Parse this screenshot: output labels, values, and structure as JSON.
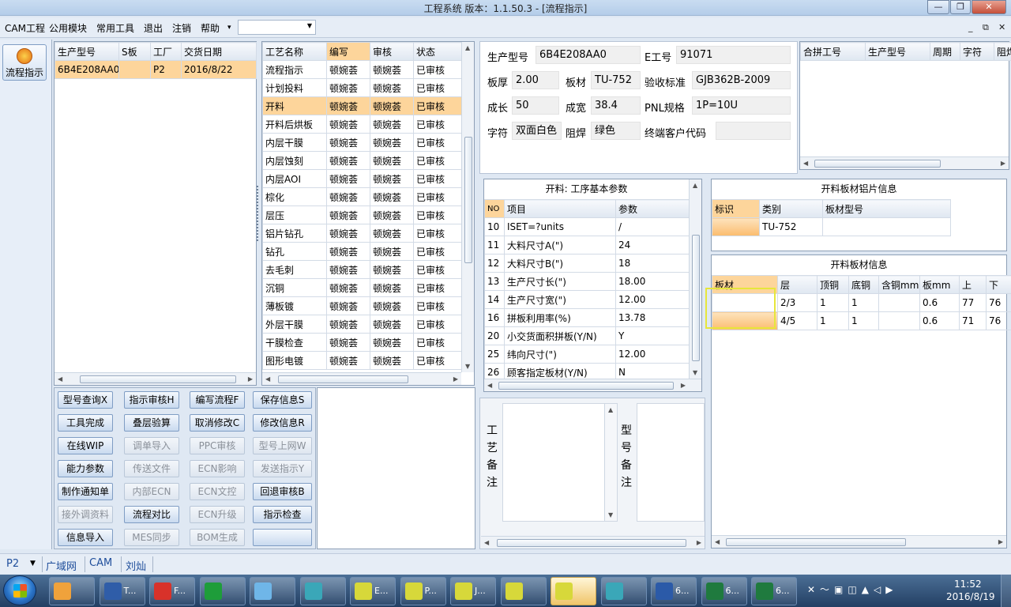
{
  "window": {
    "title": "工程系统   版本：1.1.50.3 - [流程指示]"
  },
  "menu": {
    "items": [
      "CAM工程",
      "公用模块",
      "常用工具",
      "退出",
      "注销",
      "帮助"
    ],
    "help_arrow": "▾",
    "mdi_controls": [
      "_",
      "⧉",
      "✕"
    ]
  },
  "sidebar": {
    "button_label": "流程指示"
  },
  "model_grid": {
    "columns": [
      "生产型号",
      "S板",
      "工厂",
      "交货日期"
    ],
    "rows": [
      [
        "6B4E208AA0",
        "",
        "P2",
        "2016/8/22"
      ]
    ]
  },
  "process_grid": {
    "columns": [
      "工艺名称",
      "编写",
      "审核",
      "状态"
    ],
    "selected_index": 2,
    "rows": [
      [
        "流程指示",
        "顿婉荟",
        "顿婉荟",
        "已审核"
      ],
      [
        "计划投料",
        "顿婉荟",
        "顿婉荟",
        "已审核"
      ],
      [
        "开料",
        "顿婉荟",
        "顿婉荟",
        "已审核"
      ],
      [
        "开料后烘板",
        "顿婉荟",
        "顿婉荟",
        "已审核"
      ],
      [
        "内层干膜",
        "顿婉荟",
        "顿婉荟",
        "已审核"
      ],
      [
        "内层蚀刻",
        "顿婉荟",
        "顿婉荟",
        "已审核"
      ],
      [
        "内层AOI",
        "顿婉荟",
        "顿婉荟",
        "已审核"
      ],
      [
        "棕化",
        "顿婉荟",
        "顿婉荟",
        "已审核"
      ],
      [
        "层压",
        "顿婉荟",
        "顿婉荟",
        "已审核"
      ],
      [
        "铝片钻孔",
        "顿婉荟",
        "顿婉荟",
        "已审核"
      ],
      [
        "钻孔",
        "顿婉荟",
        "顿婉荟",
        "已审核"
      ],
      [
        "去毛刺",
        "顿婉荟",
        "顿婉荟",
        "已审核"
      ],
      [
        "沉铜",
        "顿婉荟",
        "顿婉荟",
        "已审核"
      ],
      [
        "薄板镀",
        "顿婉荟",
        "顿婉荟",
        "已审核"
      ],
      [
        "外层干膜",
        "顿婉荟",
        "顿婉荟",
        "已审核"
      ],
      [
        "干膜检查",
        "顿婉荟",
        "顿婉荟",
        "已审核"
      ],
      [
        "图形电镀",
        "顿婉荟",
        "顿婉荟",
        "已审核"
      ]
    ]
  },
  "actions": {
    "rows": [
      [
        {
          "label": "型号查询X",
          "enabled": true
        },
        {
          "label": "指示审核H",
          "enabled": true
        },
        {
          "label": "编写流程F",
          "enabled": true
        },
        {
          "label": "保存信息S",
          "enabled": true
        }
      ],
      [
        {
          "label": "工具完成",
          "enabled": true
        },
        {
          "label": "叠层验算",
          "enabled": true
        },
        {
          "label": "取消修改C",
          "enabled": true
        },
        {
          "label": "修改信息R",
          "enabled": true
        }
      ],
      [
        {
          "label": "在线WIP",
          "enabled": true
        },
        {
          "label": "调单导入",
          "enabled": false
        },
        {
          "label": "PPC审核",
          "enabled": false
        },
        {
          "label": "型号上网W",
          "enabled": false
        }
      ],
      [
        {
          "label": "能力参数",
          "enabled": true
        },
        {
          "label": "传送文件",
          "enabled": false
        },
        {
          "label": "ECN影响",
          "enabled": false
        },
        {
          "label": "发送指示Y",
          "enabled": false
        }
      ],
      [
        {
          "label": "制作通知单",
          "enabled": true
        },
        {
          "label": "内部ECN",
          "enabled": false
        },
        {
          "label": "ECN文控",
          "enabled": false
        },
        {
          "label": "回退审核B",
          "enabled": true
        }
      ],
      [
        {
          "label": "接外调资料",
          "enabled": false
        },
        {
          "label": "流程对比",
          "enabled": true
        },
        {
          "label": "ECN升级",
          "enabled": false
        },
        {
          "label": "指示检查",
          "enabled": true
        }
      ],
      [
        {
          "label": "信息导入",
          "enabled": true
        },
        {
          "label": "MES同步",
          "enabled": false
        },
        {
          "label": "BOM生成",
          "enabled": false
        },
        {
          "label": "",
          "enabled": true
        }
      ]
    ]
  },
  "info": {
    "model_label": "生产型号",
    "model": "6B4E208AA0",
    "eno_label": "E工号",
    "eno": "91071",
    "thickness_label": "板厚",
    "thickness": "2.00",
    "material_label": "板材",
    "material": "TU-752",
    "standard_label": "验收标准",
    "standard": "GJB362B-2009",
    "length_label": "成长",
    "length": "50",
    "width_label": "成宽",
    "width": "38.4",
    "pnl_label": "PNL规格",
    "pnl": "1P=10U",
    "legend_label": "字符",
    "legend": "双面白色",
    "mask_label": "阻焊",
    "mask": "绿色",
    "customer_code_label": "终端客户代码",
    "customer_code": ""
  },
  "merge_grid": {
    "columns": [
      "合拼工号",
      "生产型号",
      "周期",
      "字符",
      "阻焊"
    ]
  },
  "params": {
    "title": "开料: 工序基本参数",
    "columns": [
      "NO",
      "项目",
      "参数"
    ],
    "rows": [
      [
        "10",
        "ISET=?units",
        "/"
      ],
      [
        "11",
        "大料尺寸A(\")",
        "24"
      ],
      [
        "12",
        "大料尺寸B(\")",
        "18"
      ],
      [
        "13",
        "生产尺寸长(\")",
        "18.00"
      ],
      [
        "14",
        "生产尺寸宽(\")",
        "12.00"
      ],
      [
        "16",
        "拼板利用率(%)",
        "13.78"
      ],
      [
        "20",
        "小交货面积拼板(Y/N)",
        "Y"
      ],
      [
        "25",
        "纬向尺寸(\")",
        "12.00"
      ],
      [
        "26",
        "顾客指定板材(Y/N)",
        "N"
      ]
    ]
  },
  "alu_info": {
    "title": "开料板材铝片信息",
    "columns": [
      "标识",
      "类别",
      "板材型号"
    ],
    "rows": [
      [
        "",
        "TU-752",
        ""
      ]
    ]
  },
  "sheet_info": {
    "title": "开料板材信息",
    "columns": [
      "板材",
      "层",
      "顶铜",
      "底铜",
      "含铜mm",
      "板mm",
      "上",
      "下"
    ],
    "rows": [
      [
        "",
        "2/3",
        "1",
        "1",
        "",
        "0.6",
        "77",
        "76"
      ],
      [
        "",
        "4/5",
        "1",
        "1",
        "",
        "0.6",
        "71",
        "76"
      ]
    ]
  },
  "notes": {
    "process_label": "工艺备注",
    "model_label": "型号备注"
  },
  "statusbar": {
    "factory": "P2",
    "network": "广域网",
    "dept": "CAM",
    "user": "刘灿"
  },
  "taskbar": {
    "apps": [
      {
        "label": "",
        "icon": "shell-icon"
      },
      {
        "label": "T...",
        "icon": "floppy-icon"
      },
      {
        "label": "F...",
        "icon": "foxit-icon"
      },
      {
        "label": "",
        "icon": "p-icon"
      },
      {
        "label": "",
        "icon": "notepad-icon"
      },
      {
        "label": "",
        "icon": "disc-icon"
      },
      {
        "label": "E...",
        "icon": "excel-x-icon"
      },
      {
        "label": "P...",
        "icon": "excel-x-icon"
      },
      {
        "label": "J...",
        "icon": "excel-x-icon"
      },
      {
        "label": "",
        "icon": "excel-x-icon"
      },
      {
        "label": "",
        "icon": "excel-x-icon"
      },
      {
        "label": "",
        "icon": "disc-icon"
      },
      {
        "label": "6...",
        "icon": "word-icon"
      },
      {
        "label": "6...",
        "icon": "excel-icon"
      },
      {
        "label": "6...",
        "icon": "excel-icon"
      }
    ],
    "time": "11:52",
    "date": "2016/8/19"
  },
  "colors": {
    "selected_row": "#fdd59b",
    "highlight_box": "#e6e63c",
    "link_blue": "#1f4e9b"
  }
}
